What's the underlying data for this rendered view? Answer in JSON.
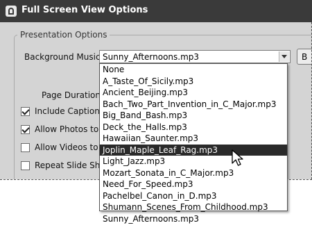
{
  "window": {
    "title": "Full Screen View Options",
    "icon": "app-icon"
  },
  "presentation_options": {
    "group_label": "Presentation Options",
    "background_music_label": "Background Music:",
    "background_music_value": "Sunny_Afternoons.mp3",
    "browse_button_label": "B",
    "page_duration_label": "Page Duration:",
    "checkboxes": [
      {
        "label": "Include Captions",
        "checked": true
      },
      {
        "label": "Allow Photos to R",
        "checked": true
      },
      {
        "label": "Allow Videos to R",
        "checked": false
      },
      {
        "label": "Repeat Slide Show",
        "checked": false
      }
    ]
  },
  "music_dropdown": {
    "options": [
      "None",
      "A_Taste_Of_Sicily.mp3",
      "Ancient_Beijing.mp3",
      "Bach_Two_Part_Invention_in_C_Major.mp3",
      "Big_Band_Bash.mp3",
      "Deck_the_Halls.mp3",
      "Hawaiian_Saunter.mp3",
      "Joplin_Maple_Leaf_Rag.mp3",
      "Light_Jazz.mp3",
      "Mozart_Sonata_in_C_Major.mp3",
      "Need_For_Speed.mp3",
      "Pachelbel_Canon_in_D.mp3",
      "Shumann_Scenes_From_Childhood.mp3",
      "Sunny_Afternoons.mp3"
    ],
    "highlighted": "Joplin_Maple_Leaf_Rag.mp3"
  }
}
